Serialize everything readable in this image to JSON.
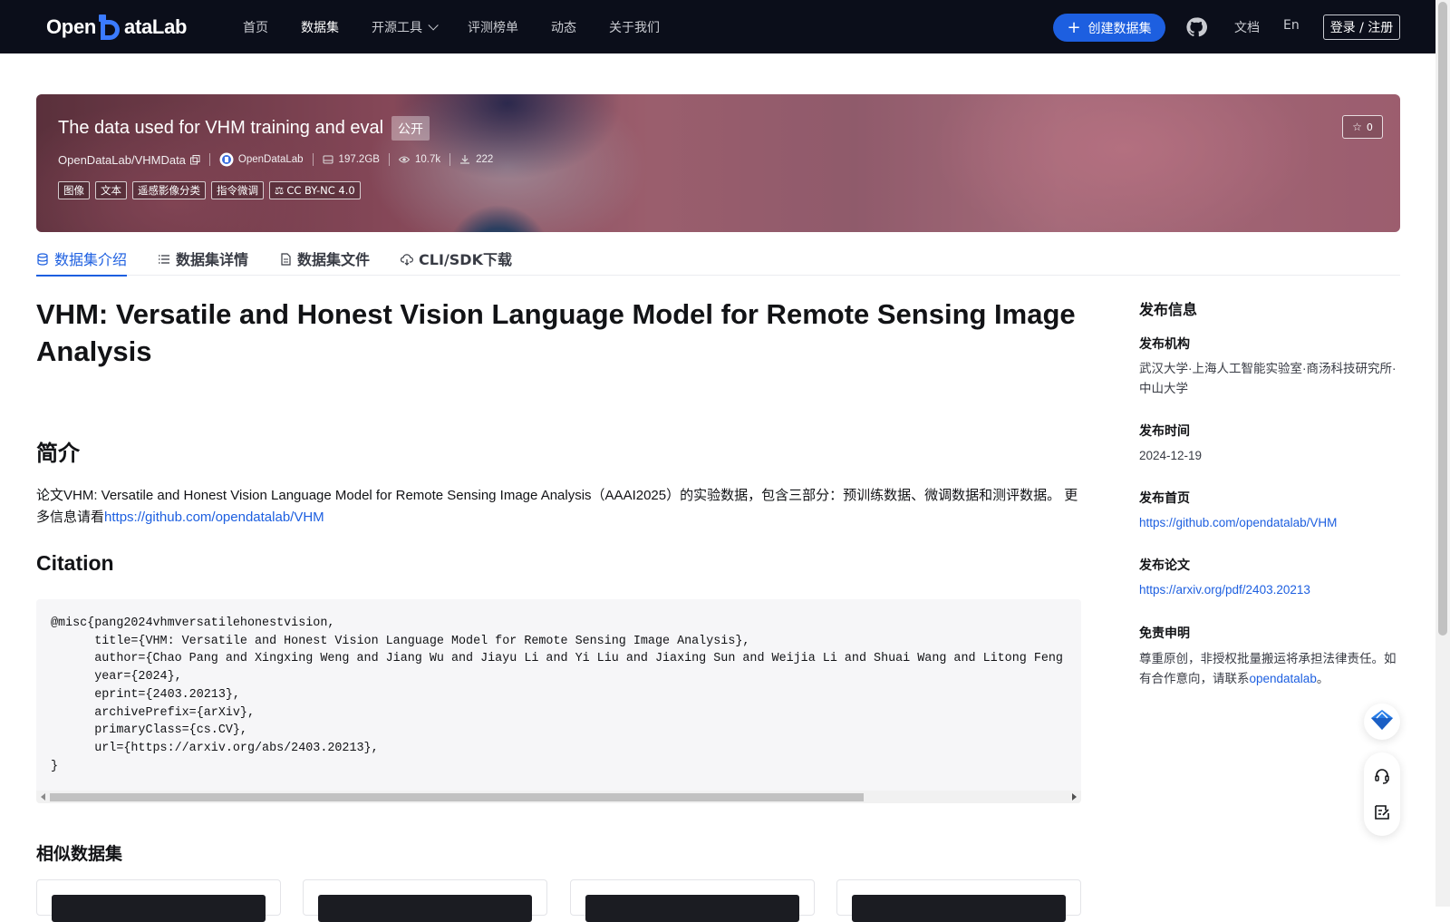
{
  "nav": {
    "logo_text_left": "Open",
    "logo_text_right": "ataLab",
    "links": [
      {
        "label": "首页",
        "active": false
      },
      {
        "label": "数据集",
        "active": true
      },
      {
        "label": "开源工具",
        "active": false,
        "dropdown": true
      },
      {
        "label": "评测榜单",
        "active": false
      },
      {
        "label": "动态",
        "active": false
      },
      {
        "label": "关于我们",
        "active": false
      }
    ],
    "create_button": "创建数据集",
    "docs": "文档",
    "lang": "En",
    "login": "登录 / 注册"
  },
  "banner": {
    "title": "The data used for VHM training and eval",
    "visibility_badge": "公开",
    "repo": "OpenDataLab/VHMData",
    "publisher": "OpenDataLab",
    "size": "197.2GB",
    "views": "10.7k",
    "downloads": "222",
    "tags": [
      "图像",
      "文本",
      "遥感影像分类",
      "指令微调"
    ],
    "license": "CC BY-NC 4.0",
    "stars": "0"
  },
  "tabs": [
    "数据集介绍",
    "数据集详情",
    "数据集文件",
    "CLI/SDK下载"
  ],
  "main": {
    "title": "VHM: Versatile and Honest Vision Language Model for Remote Sensing Image Analysis",
    "intro_heading": "简介",
    "intro_text": "论文VHM: Versatile and Honest Vision Language Model for Remote Sensing Image Analysis（AAAI2025）的实验数据，包含三部分：预训练数据、微调数据和测评数据。 更多信息请看",
    "intro_link": "https://github.com/opendatalab/VHM",
    "citation_heading": "Citation",
    "citation_code": "@misc{pang2024vhmversatilehonestvision,\n      title={VHM: Versatile and Honest Vision Language Model for Remote Sensing Image Analysis},\n      author={Chao Pang and Xingxing Weng and Jiang Wu and Jiayu Li and Yi Liu and Jiaxing Sun and Weijia Li and Shuai Wang and Litong Feng\n      year={2024},\n      eprint={2403.20213},\n      archivePrefix={arXiv},\n      primaryClass={cs.CV},\n      url={https://arxiv.org/abs/2403.20213},\n}",
    "similar_heading": "相似数据集"
  },
  "sidebar": {
    "heading": "发布信息",
    "org_label": "发布机构",
    "org_value": "武汉大学·上海人工智能实验室·商汤科技研究所·中山大学",
    "date_label": "发布时间",
    "date_value": "2024-12-19",
    "homepage_label": "发布首页",
    "homepage_value": "https://github.com/opendatalab/VHM",
    "paper_label": "发布论文",
    "paper_value": "https://arxiv.org/pdf/2403.20213",
    "disclaimer_label": "免责申明",
    "disclaimer_text": "尊重原创，非授权批量搬运将承担法律责任。如有合作意向，请联系",
    "disclaimer_link": "opendatalab",
    "disclaimer_end": "。"
  },
  "colors": {
    "nav_bg": "#0b0e1a",
    "accent": "#1d5fe0",
    "text": "#121316",
    "code_bg": "#f6f6f8"
  }
}
